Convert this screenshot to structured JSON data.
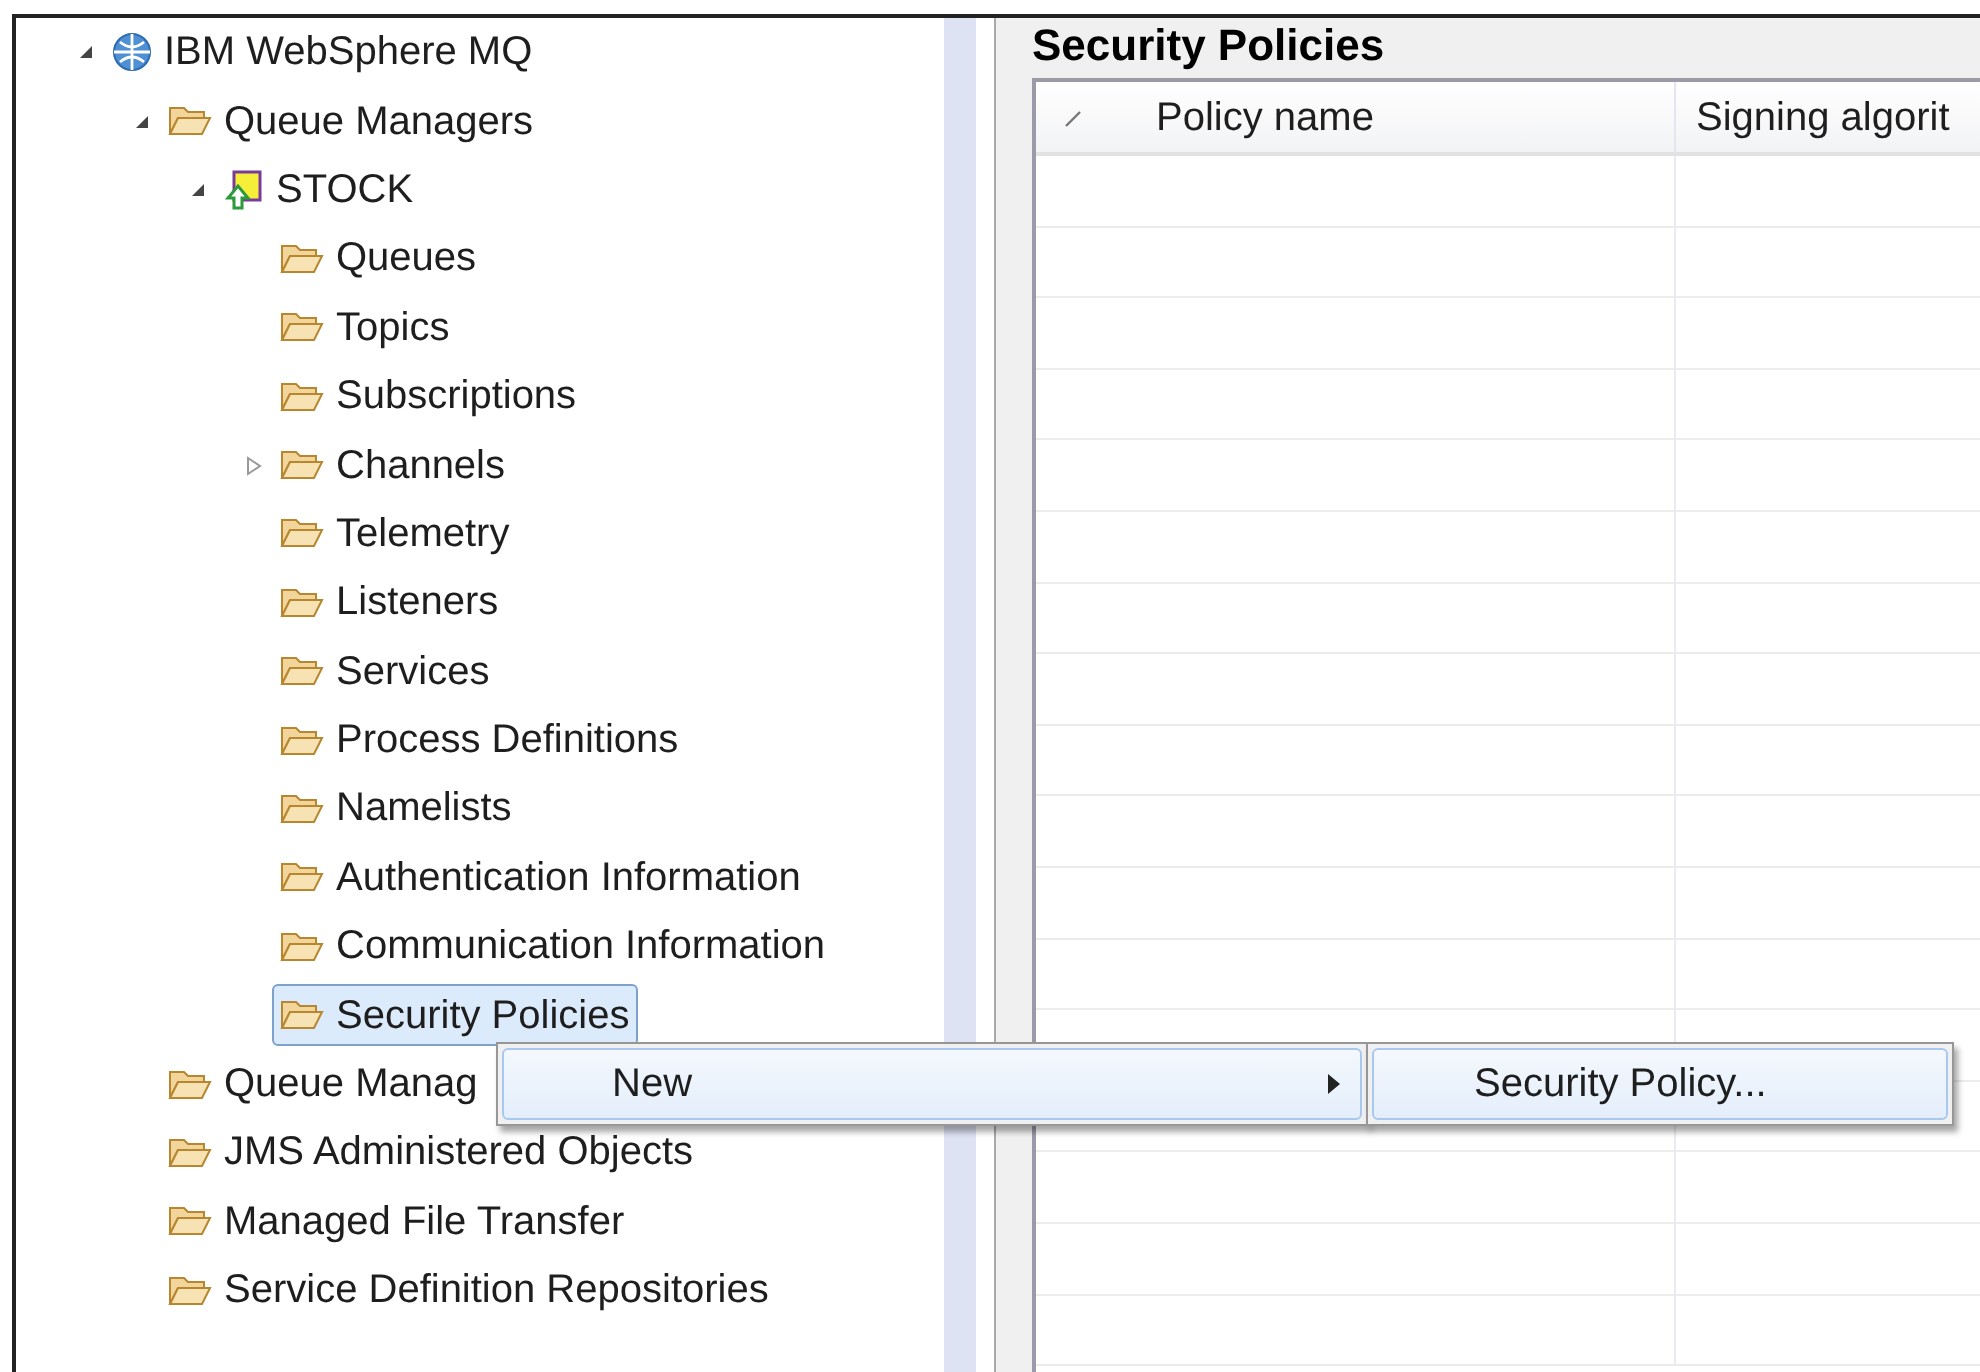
{
  "tree": [
    {
      "label": "IBM WebSphere MQ",
      "kind": "globe",
      "expanded": true,
      "selected": false,
      "children": [
        {
          "label": "Queue Managers",
          "kind": "folder",
          "expanded": true,
          "selected": false,
          "children": [
            {
              "label": "STOCK",
              "kind": "queue-manager",
              "expanded": true,
              "selected": false,
              "children": [
                {
                  "label": "Queues",
                  "kind": "folder",
                  "selected": false
                },
                {
                  "label": "Topics",
                  "kind": "folder",
                  "selected": false
                },
                {
                  "label": "Subscriptions",
                  "kind": "folder",
                  "selected": false
                },
                {
                  "label": "Channels",
                  "kind": "folder",
                  "expanded": false,
                  "selected": false
                },
                {
                  "label": "Telemetry",
                  "kind": "folder",
                  "selected": false
                },
                {
                  "label": "Listeners",
                  "kind": "folder",
                  "selected": false
                },
                {
                  "label": "Services",
                  "kind": "folder",
                  "selected": false
                },
                {
                  "label": "Process Definitions",
                  "kind": "folder",
                  "selected": false
                },
                {
                  "label": "Namelists",
                  "kind": "folder",
                  "selected": false
                },
                {
                  "label": "Authentication Information",
                  "kind": "folder",
                  "selected": false
                },
                {
                  "label": "Communication Information",
                  "kind": "folder",
                  "selected": false
                },
                {
                  "label": "Security Policies",
                  "kind": "folder",
                  "selected": true
                }
              ]
            }
          ]
        },
        {
          "label": "Queue Manag",
          "kind": "folder",
          "selected": false
        },
        {
          "label": "JMS Administered Objects",
          "kind": "folder",
          "selected": false
        },
        {
          "label": "Managed File Transfer",
          "kind": "folder",
          "selected": false
        },
        {
          "label": "Service Definition Repositories",
          "kind": "folder",
          "selected": false
        }
      ]
    }
  ],
  "panel": {
    "title": "Security Policies",
    "table": {
      "columns": [
        "Policy name",
        "Signing algorit"
      ]
    }
  },
  "context_menu": {
    "items": [
      {
        "label": "New",
        "selected": true,
        "submenu": true
      }
    ],
    "submenu": {
      "items": [
        {
          "label": "Security Policy...",
          "selected": true
        }
      ]
    }
  }
}
